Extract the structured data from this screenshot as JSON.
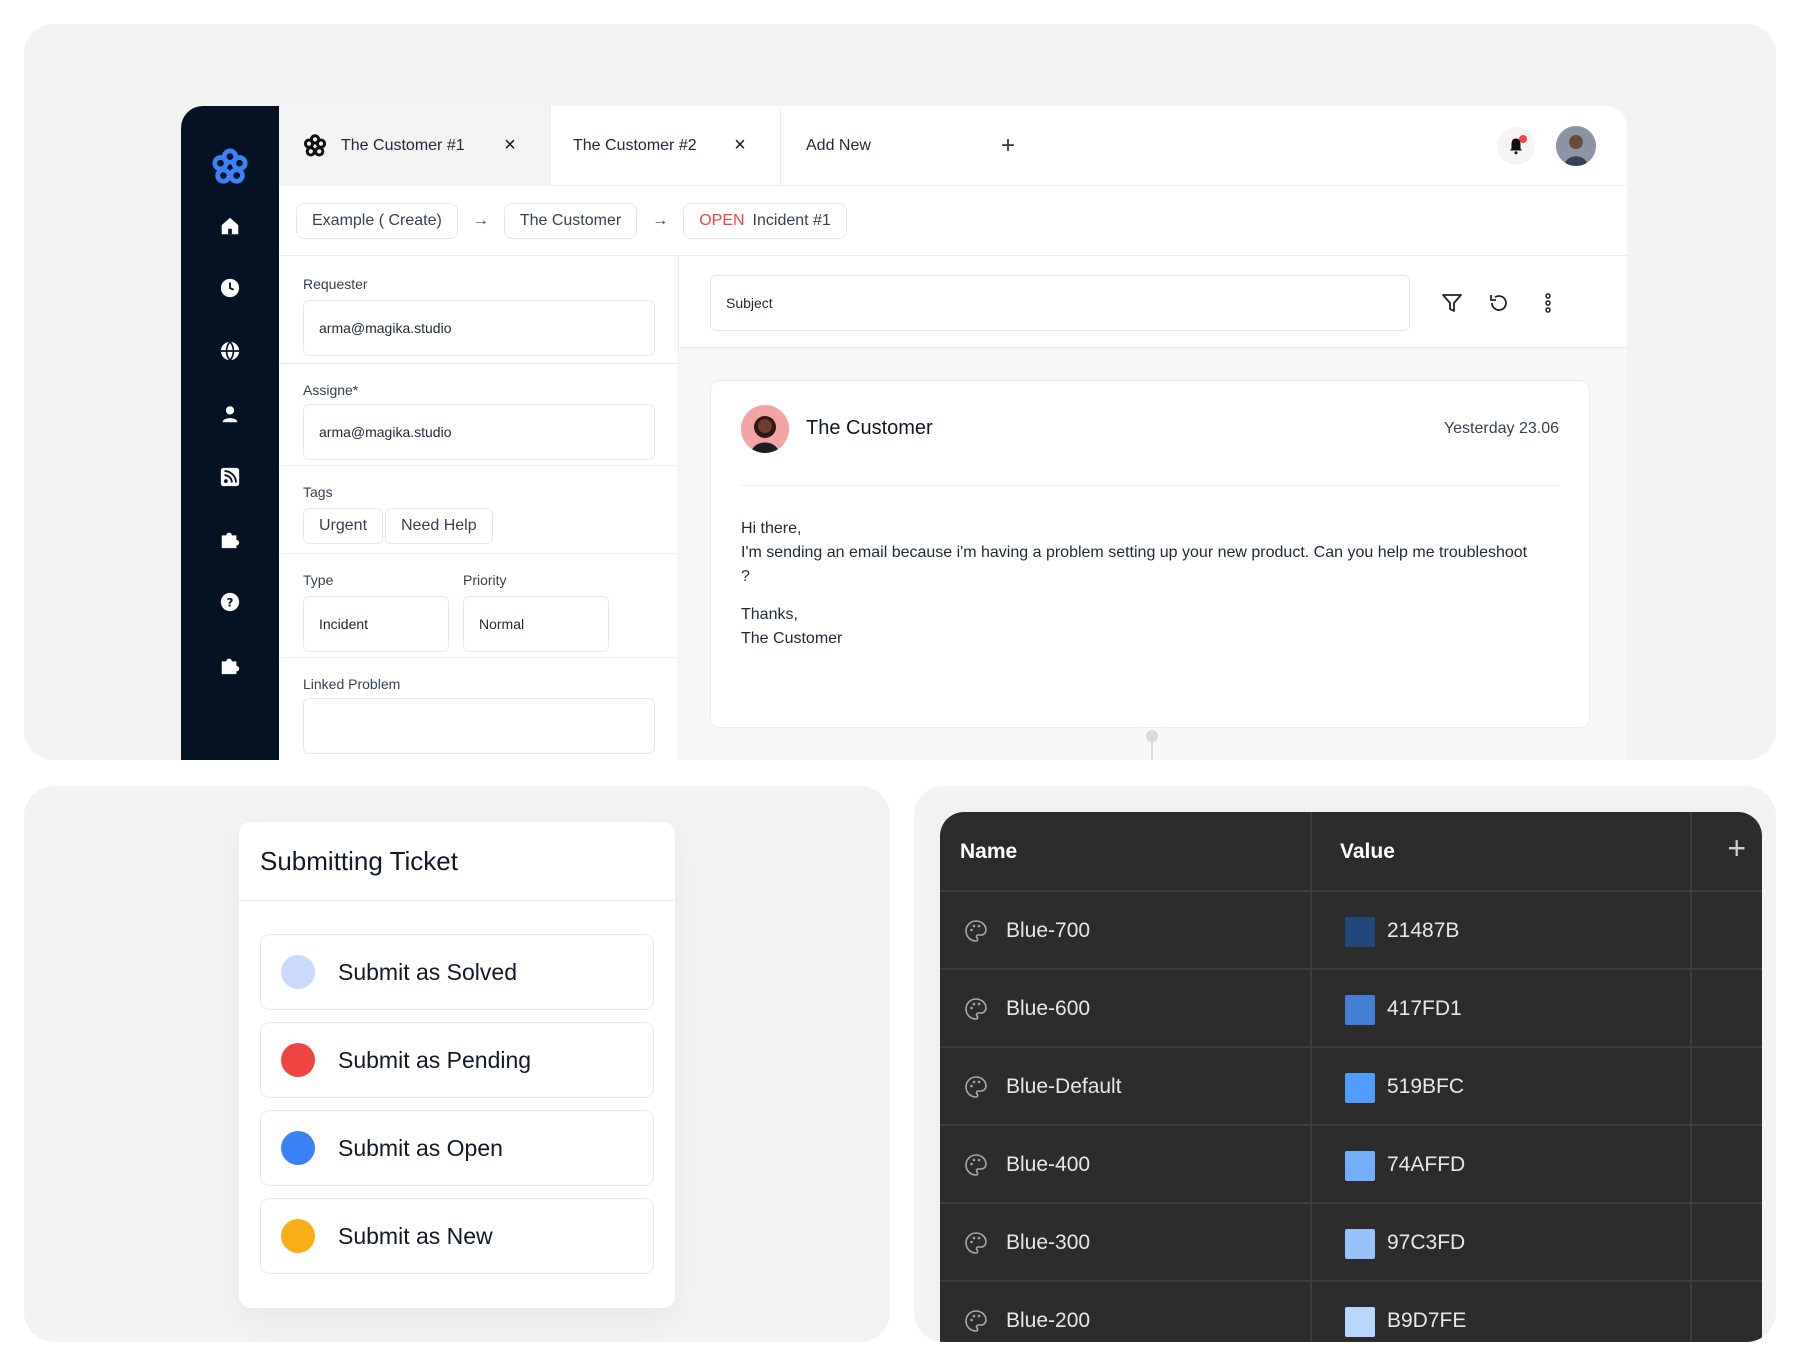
{
  "tabs": [
    {
      "label": "The Customer #1"
    },
    {
      "label": "The Customer #2"
    }
  ],
  "add_new_label": "Add New",
  "breadcrumb": {
    "first": "Example ( Create)",
    "second": "The Customer",
    "status": "OPEN",
    "third": "Incident #1"
  },
  "form": {
    "requester_label": "Requester",
    "requester_value": "arma@magika.studio",
    "assignee_label": "Assigne*",
    "assignee_value": "arma@magika.studio",
    "tags_label": "Tags",
    "tags": [
      "Urgent",
      "Need Help"
    ],
    "type_label": "Type",
    "type_value": "Incident",
    "priority_label": "Priority",
    "priority_value": "Normal",
    "linked_label": "Linked Problem"
  },
  "conversation": {
    "subject_placeholder": "Subject",
    "sender": "The Customer",
    "time": "Yesterday 23.06",
    "body": {
      "greeting": "Hi there,",
      "text": "I'm sending an email because i'm having a problem setting up your new product. Can you help me troubleshoot ?",
      "thanks": "Thanks,",
      "signature": "The Customer"
    }
  },
  "ticket": {
    "title": "Submitting Ticket",
    "options": [
      {
        "label": "Submit as Solved",
        "color": "#C9DAFB"
      },
      {
        "label": "Submit as Pending",
        "color": "#EF4444"
      },
      {
        "label": "Submit as Open",
        "color": "#3B82F6"
      },
      {
        "label": "Submit as New",
        "color": "#FBAE17"
      }
    ]
  },
  "color_table": {
    "headers": {
      "name": "Name",
      "value": "Value"
    },
    "rows": [
      {
        "name": "Blue-700",
        "value": "21487B",
        "color": "#21487B"
      },
      {
        "name": "Blue-600",
        "value": "417FD1",
        "color": "#417FD1"
      },
      {
        "name": "Blue-Default",
        "value": "519BFC",
        "color": "#519BFC"
      },
      {
        "name": "Blue-400",
        "value": "74AFFD",
        "color": "#74AFFD"
      },
      {
        "name": "Blue-300",
        "value": "97C3FD",
        "color": "#97C3FD"
      },
      {
        "name": "Blue-200",
        "value": "B9D7FE",
        "color": "#B9D7FE"
      }
    ]
  },
  "colors": {
    "brand": "#3B82F6",
    "sidebar": "#041223",
    "status_open": "#EF4444"
  },
  "icons": [
    "logo-icon",
    "home-icon",
    "clock-icon",
    "globe-icon",
    "user-icon",
    "rss-icon",
    "puzzle-icon",
    "help-icon",
    "bell-icon",
    "filter-icon",
    "refresh-icon",
    "more-icon",
    "palette-icon",
    "plus-icon",
    "close-icon",
    "arrow-right-icon"
  ]
}
